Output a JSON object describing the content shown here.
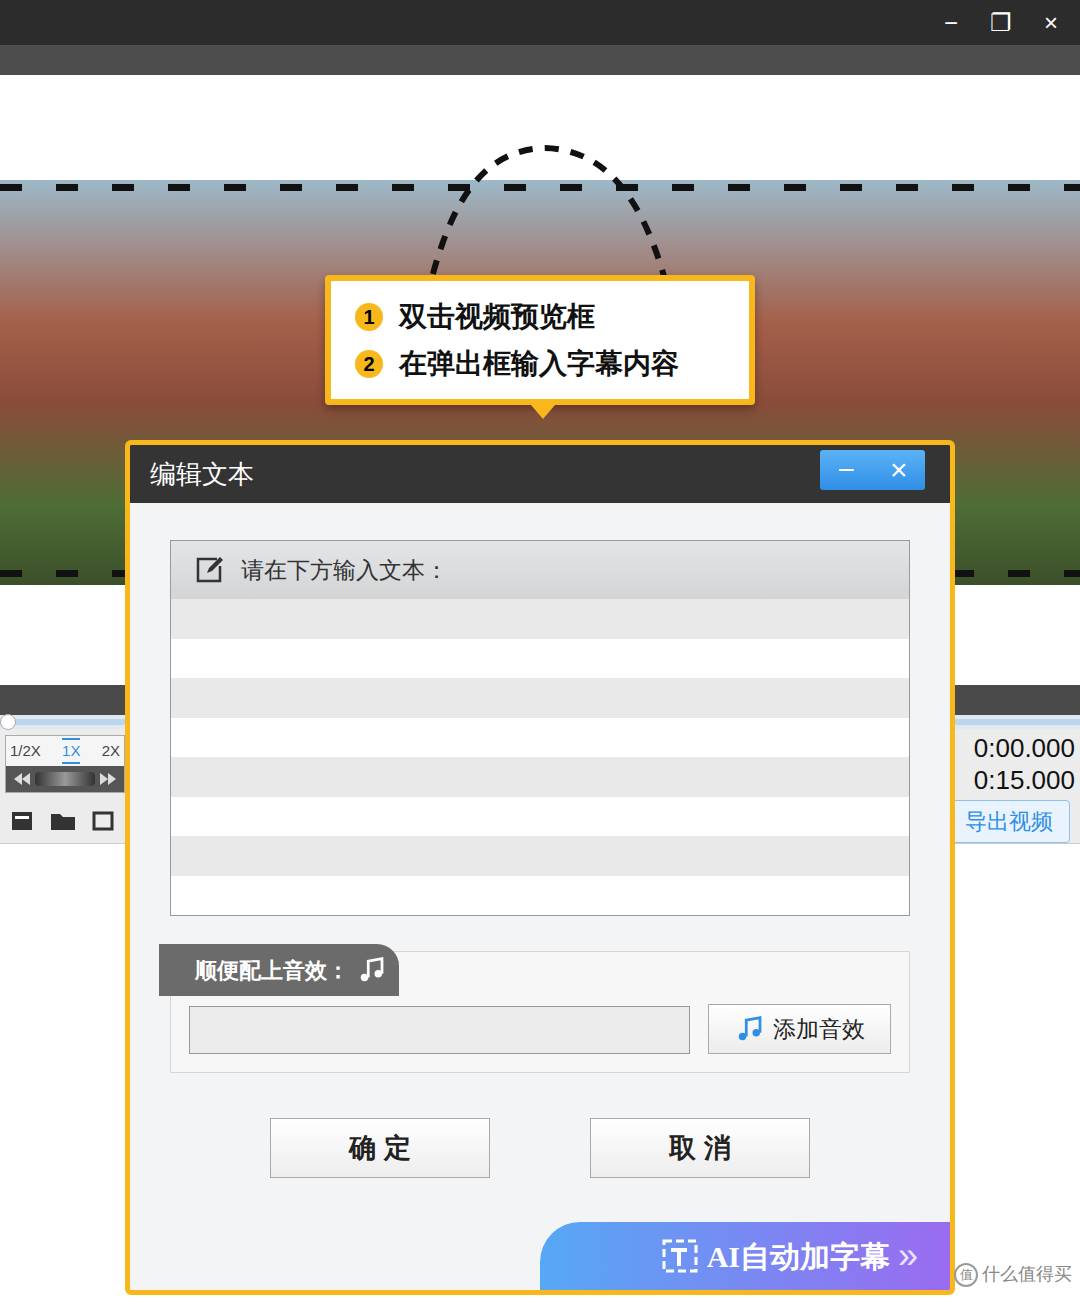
{
  "window": {
    "controls": [
      "−",
      "❐",
      "×"
    ]
  },
  "preview": {
    "callout": {
      "steps": [
        {
          "number": "1",
          "text": "双击视频预览框"
        },
        {
          "number": "2",
          "text": "在弹出框输入字幕内容"
        }
      ]
    }
  },
  "playback": {
    "speeds": [
      {
        "label": "1/2X",
        "selected": false
      },
      {
        "label": "1X",
        "selected": true
      },
      {
        "label": "2X",
        "selected": false
      }
    ],
    "level": 0,
    "current_time": "0:00.000",
    "total_time": "0:15.000",
    "export_button": "导出视频"
  },
  "dialog": {
    "title": "编辑文本",
    "controls": [
      "−",
      "×"
    ],
    "text_prompt": "请在下方输入文本：",
    "text_value": "",
    "sound_label": "顺便配上音效：",
    "sound_value": "",
    "add_sound_button": "添加音效",
    "buttons": [
      "确 定",
      "取 消"
    ],
    "ai_button": "AI自动加字幕",
    "ai_arrow": "»"
  },
  "watermark": {
    "logo": "值",
    "text": "什么值得买"
  }
}
